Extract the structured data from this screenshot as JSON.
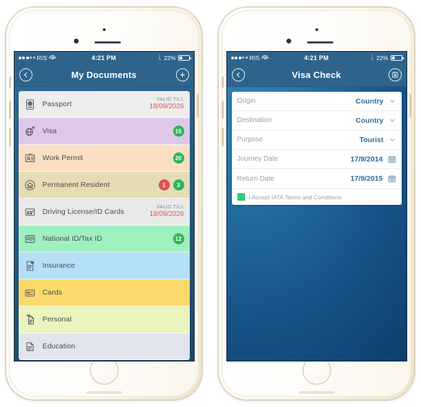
{
  "statusbar": {
    "carrier": "RIS",
    "signal_filled": 3,
    "signal_empty": 2,
    "wifi_icon": "wifi-icon",
    "time": "4:21 PM",
    "bluetooth_icon": "bluetooth-icon",
    "battery_pct": "22%",
    "battery_icon": "battery-icon"
  },
  "phone_left": {
    "navbar": {
      "back_icon": "back-arrow-icon",
      "title": "My Documents",
      "add_icon": "plus-icon"
    },
    "documents": [
      {
        "label": "Passport",
        "icon": "passport-icon",
        "bg": "#ededee",
        "valid_label": "VALID TILL",
        "valid_date": "18/09/2026"
      },
      {
        "label": "Visa",
        "icon": "globe-arrow-icon",
        "bg": "#ddc8ea",
        "badges": [
          {
            "value": "15",
            "color": "#2eb85c"
          }
        ]
      },
      {
        "label": "Work Permit",
        "icon": "id-badge-icon",
        "bg": "#fbdfc3",
        "badges": [
          {
            "value": "20",
            "color": "#2eb85c"
          }
        ]
      },
      {
        "label": "Permanent Resident",
        "icon": "house-icon",
        "bg": "#e6dcb4",
        "badges": [
          {
            "value": "1",
            "color": "#e5534b"
          },
          {
            "value": "3",
            "color": "#2eb85c"
          }
        ]
      },
      {
        "label": "Driving License/ID Cards",
        "icon": "car-card-icon",
        "bg": "#e9e9ea",
        "valid_label": "VALID TILL",
        "valid_date": "18/09/2026"
      },
      {
        "label": "National ID/Tax ID",
        "icon": "national-id-icon",
        "bg": "#9ff0c0",
        "badges": [
          {
            "value": "12",
            "color": "#2eb85c"
          }
        ]
      },
      {
        "label": "Insurance",
        "icon": "insurance-doc-icon",
        "bg": "#b3e0f7"
      },
      {
        "label": "Cards",
        "icon": "cards-icon",
        "bg": "#fbd96b"
      },
      {
        "label": "Personal",
        "icon": "personal-docs-icon",
        "bg": "#eaf5bd"
      },
      {
        "label": "Education",
        "icon": "education-doc-icon",
        "bg": "#e2e4ee"
      }
    ]
  },
  "phone_right": {
    "navbar": {
      "back_icon": "back-arrow-icon",
      "title": "Visa Check",
      "action_icon": "camera-save-icon"
    },
    "form": [
      {
        "label": "Origin",
        "value": "Country",
        "control": "chevron-down-icon"
      },
      {
        "label": "Destination",
        "value": "Country",
        "control": "chevron-down-icon"
      },
      {
        "label": "Purpose",
        "value": "Tourist",
        "control": "chevron-down-icon"
      },
      {
        "label": "Journey Date",
        "value": "17/9/2014",
        "control": "calendar-icon"
      },
      {
        "label": "Return Date",
        "value": "17/9/2015",
        "control": "calendar-icon"
      }
    ],
    "terms": {
      "checkbox": "checkbox-checked",
      "label": "I Accept IATA Terms and Conditions",
      "checkbox_color": "#2ecc71"
    }
  },
  "theme": {
    "navbar_bg": "#2e648c",
    "screen_bg_left": "#245a80",
    "screen_bg_right": "#17558a",
    "value_color": "#2f6a96",
    "expiry_color": "#e0553f"
  }
}
